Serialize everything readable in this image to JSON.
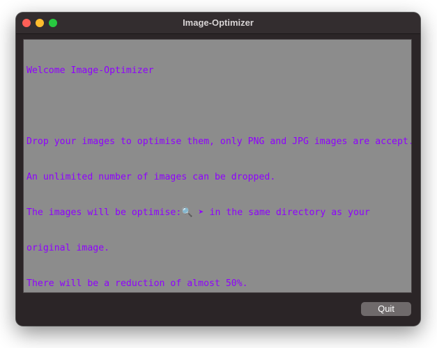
{
  "window": {
    "title": "Image-Optimizer"
  },
  "text_area": {
    "lines": [
      "Welcome Image-Optimizer",
      "",
      "Drop your images to optimise them, only PNG and JPG images are accept.",
      "An unlimited number of images can be dropped.",
      "The images will be optimise:🔍 ➤ in the same directory as your",
      "original image.",
      "There will be a reduction of almost 50%."
    ]
  },
  "footer": {
    "quit_label": "Quit"
  },
  "colors": {
    "text": "#8f00ff",
    "text_area_bg": "#8c8c8c",
    "window_bg": "#2b2527"
  }
}
